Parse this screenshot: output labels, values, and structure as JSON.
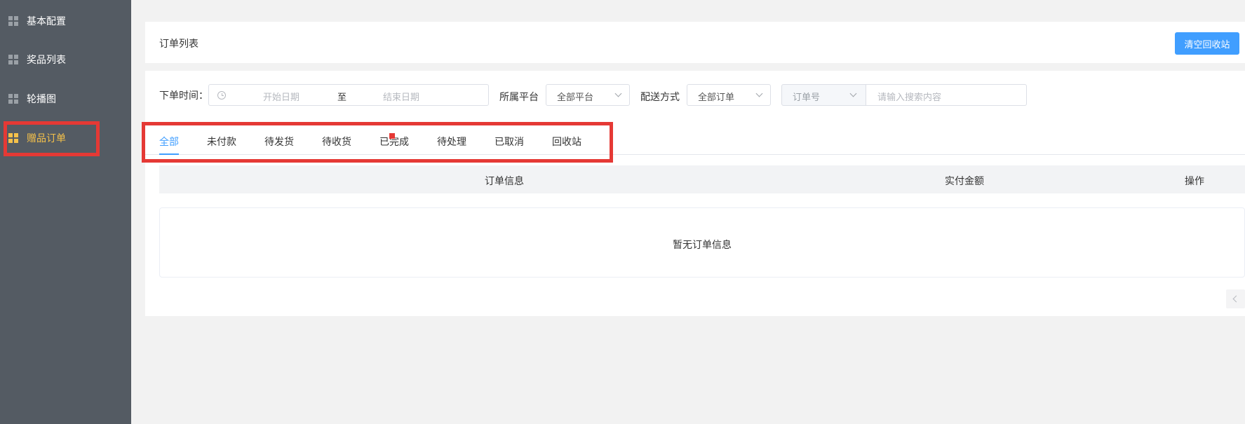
{
  "sidebar": {
    "items": [
      {
        "label": "基本配置"
      },
      {
        "label": "奖品列表"
      },
      {
        "label": "轮播图"
      },
      {
        "label": "赠品订单"
      }
    ]
  },
  "header": {
    "title": "订单列表",
    "clear_button": "清空回收站"
  },
  "filters": {
    "order_time_label": "下单时间：",
    "start_date_placeholder": "开始日期",
    "range_separator": "至",
    "end_date_placeholder": "结束日期",
    "platform_label": "所属平台",
    "platform_value": "全部平台",
    "delivery_label": "配送方式",
    "delivery_value": "全部订单",
    "search_type_placeholder": "订单号",
    "search_placeholder": "请输入搜索内容"
  },
  "tabs": [
    {
      "label": "全部"
    },
    {
      "label": "未付款"
    },
    {
      "label": "待发货"
    },
    {
      "label": "待收货"
    },
    {
      "label": "已完成"
    },
    {
      "label": "待处理"
    },
    {
      "label": "已取消"
    },
    {
      "label": "回收站"
    }
  ],
  "table": {
    "columns": [
      "订单信息",
      "实付金额",
      "操作"
    ],
    "empty_text": "暂无订单信息"
  },
  "colors": {
    "accent": "#409eff",
    "sidebar_bg": "#545b63",
    "active_menu": "#f5c14a",
    "highlight": "#e53935"
  }
}
